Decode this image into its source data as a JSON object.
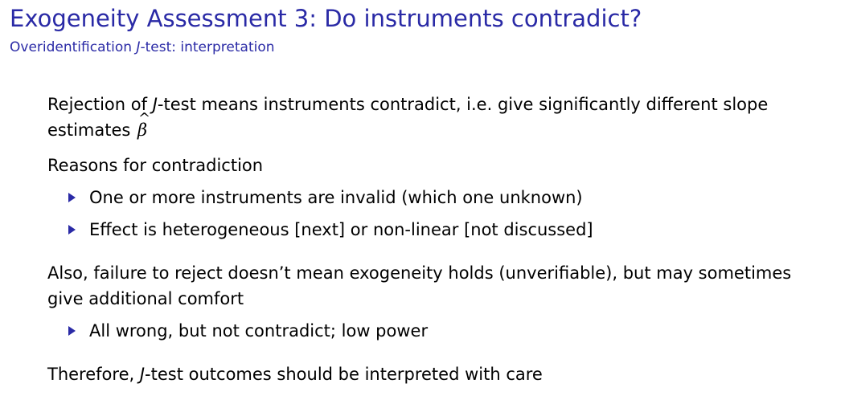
{
  "header": {
    "title": "Exogeneity Assessment 3: Do instruments contradict?",
    "subtitle_pre": "Overidentification ",
    "subtitle_j": "J",
    "subtitle_post": "-test: interpretation"
  },
  "content": {
    "p1": {
      "pre": "Rejection of ",
      "j": "J",
      "mid": "-test means instruments contradict, i.e. give significantly different slope estimates ",
      "symbol": "β",
      "hat": "^"
    },
    "p2": "Reasons for contradiction",
    "bullets1": [
      "One or more instruments are invalid (which one unknown)",
      "Effect is heterogeneous [next] or non-linear [not discussed]"
    ],
    "p3": "Also, failure to reject doesn’t mean exogeneity holds (unverifiable), but may sometimes give additional comfort",
    "bullets2": [
      "All wrong, but not contradict; low power"
    ],
    "p4": {
      "pre": "Therefore, ",
      "j": "J",
      "post": "-test outcomes should be interpreted with care"
    }
  },
  "colors": {
    "accent": "#2a2aa6",
    "text": "#000000",
    "background": "#ffffff"
  }
}
